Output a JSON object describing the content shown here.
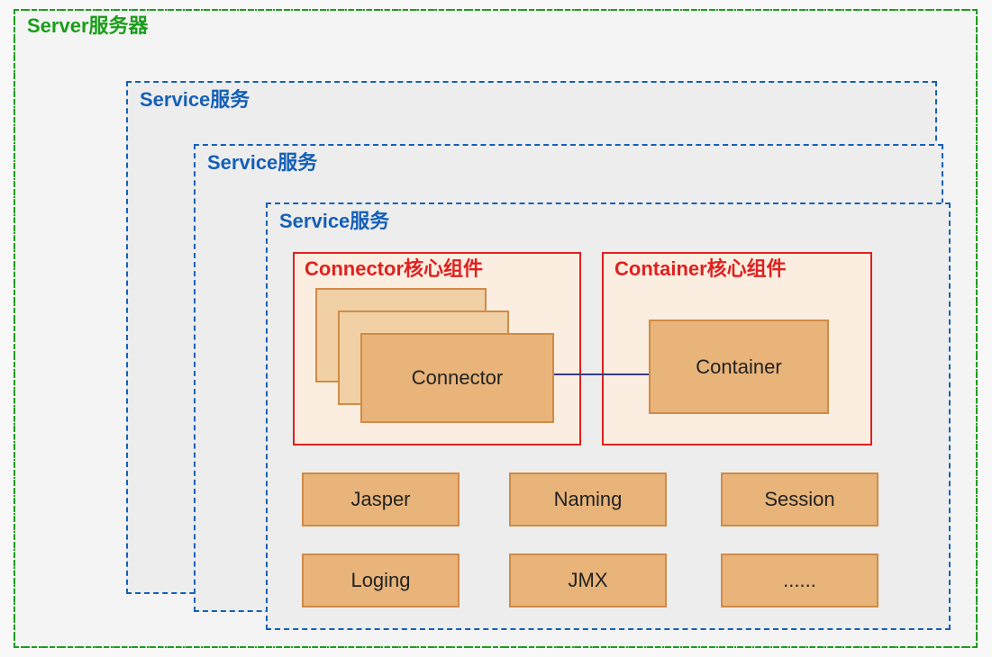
{
  "server": {
    "label": "Server服务器"
  },
  "services": {
    "label": "Service服务"
  },
  "connectorGroup": {
    "label": "Connector核心组件",
    "box": "Connector"
  },
  "containerGroup": {
    "label": "Container核心组件",
    "box": "Container"
  },
  "modules": {
    "r1c1": "Jasper",
    "r1c2": "Naming",
    "r1c3": "Session",
    "r2c1": "Loging",
    "r2c2": "JMX",
    "r2c3": "......"
  }
}
